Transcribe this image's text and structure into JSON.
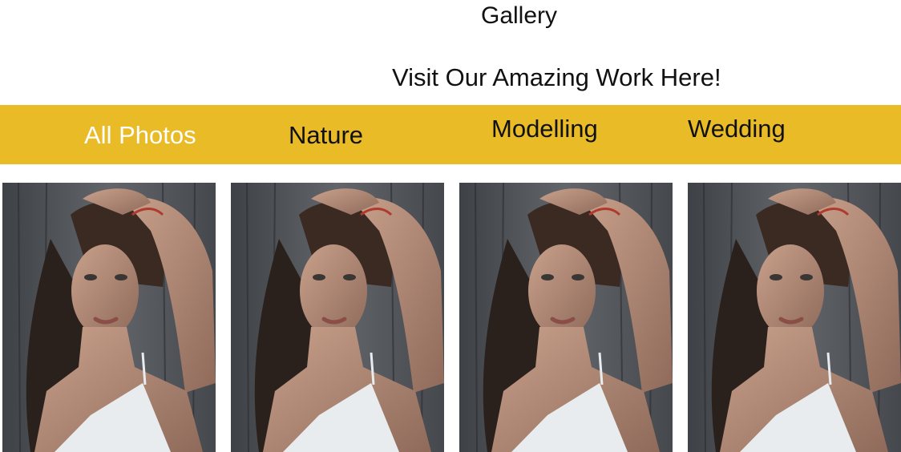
{
  "header": {
    "title": "Gallery",
    "subtitle": "Visit Our Amazing Work Here!"
  },
  "filters": [
    {
      "label": "All Photos",
      "active": true
    },
    {
      "label": "Nature",
      "active": false
    },
    {
      "label": "Modelling",
      "active": false
    },
    {
      "label": "Wedding",
      "active": false
    }
  ],
  "colors": {
    "accent": "#e8bb27",
    "active_text": "#ffffff",
    "text": "#111111"
  },
  "gallery": {
    "photos": [
      {
        "subject": "portrait-woman"
      },
      {
        "subject": "portrait-woman"
      },
      {
        "subject": "portrait-woman"
      },
      {
        "subject": "portrait-woman"
      }
    ]
  }
}
